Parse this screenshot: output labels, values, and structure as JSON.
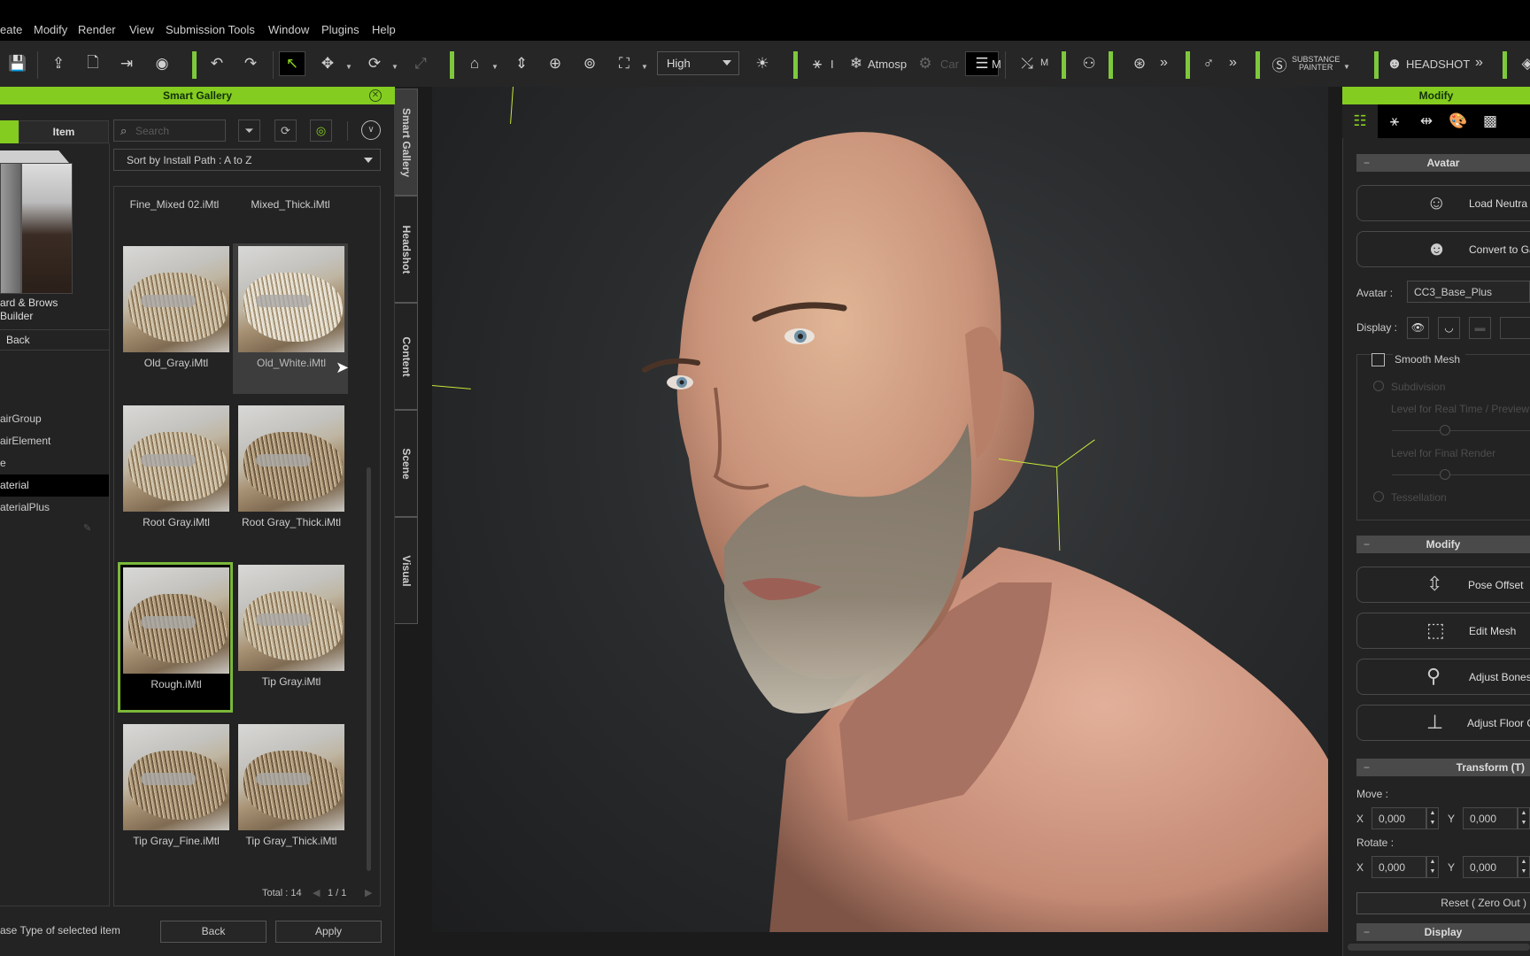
{
  "menubar": {
    "items": [
      "eate",
      "Modify",
      "Render",
      "View",
      "Submission Tools",
      "Window",
      "Plugins",
      "Help"
    ]
  },
  "toolbar": {
    "quality_select": "High",
    "atmosphere_label": "Atmosp",
    "camera_label": "Car",
    "modify_label": "M",
    "motion_label": "M",
    "substance_label_1": "SUBSTANCE",
    "substance_label_2": "PAINTER",
    "headshot_label": "HEADSHOT",
    "more_glyph": "»",
    "accent_color": "#7ec83c"
  },
  "gallery": {
    "title": "Smart Gallery",
    "tab_item": "Item",
    "search_placeholder": "Search",
    "sort_label": "Sort by Install Path : A to Z",
    "builder_label_1": "ard & Brows",
    "builder_label_2": " Builder",
    "back_row": "Back",
    "tree": [
      {
        "label": "airGroup",
        "selected": false
      },
      {
        "label": "airElement",
        "selected": false
      },
      {
        "label": "e",
        "selected": false
      },
      {
        "label": "aterial",
        "selected": true
      },
      {
        "label": "aterialPlus",
        "selected": false
      }
    ],
    "top_labels": [
      "Fine_Mixed 02.iMtl",
      "Mixed_Thick.iMtl"
    ],
    "items": [
      {
        "label": "Old_Gray.iMtl",
        "state": "normal"
      },
      {
        "label": "Old_White.iMtl",
        "state": "hover"
      },
      {
        "label": "Root Gray.iMtl",
        "state": "normal"
      },
      {
        "label": "Root Gray_Thick.iMtl",
        "state": "normal"
      },
      {
        "label": "Rough.iMtl",
        "state": "selected"
      },
      {
        "label": "Tip Gray.iMtl",
        "state": "normal"
      },
      {
        "label": "Tip Gray_Fine.iMtl",
        "state": "normal"
      },
      {
        "label": "Tip Gray_Thick.iMtl",
        "state": "normal"
      }
    ],
    "total": "Total : 14",
    "page": "1  /  1",
    "status_hint": "ase Type of selected item",
    "back_button": "Back",
    "apply_button": "Apply"
  },
  "side_tabs": [
    "Smart Gallery",
    "Headshot",
    "Content",
    "Scene",
    "Visual"
  ],
  "modify": {
    "title": "Modify",
    "avatar_section": "Avatar",
    "load_neutral": "Load Neutra",
    "convert": "Convert to Ga",
    "avatar_label": "Avatar :",
    "avatar_value": "CC3_Base_Plus",
    "display_label": "Display :",
    "smooth_mesh": "Smooth Mesh",
    "smooth_mesh_checked": false,
    "subdivision": "Subdivision",
    "level_realtime": "Level for Real Time / Preview",
    "level_final": "Level for Final Render",
    "tessellation": "Tessellation",
    "modify_section": "Modify",
    "pose_offset": "Pose Offset",
    "edit_mesh": "Edit Mesh",
    "adjust_bones": "Adjust Bones",
    "adjust_floor": "Adjust Floor C",
    "transform_section": "Transform  (T)",
    "move_label": "Move :",
    "rotate_label": "Rotate :",
    "x_label": "X",
    "y_label": "Y",
    "move_x": "0,000",
    "move_y": "0,000",
    "rotate_x": "0,000",
    "rotate_y": "0,000",
    "reset": "Reset ( Zero Out )",
    "display_section": "Display",
    "collapse_glyph": "−"
  }
}
